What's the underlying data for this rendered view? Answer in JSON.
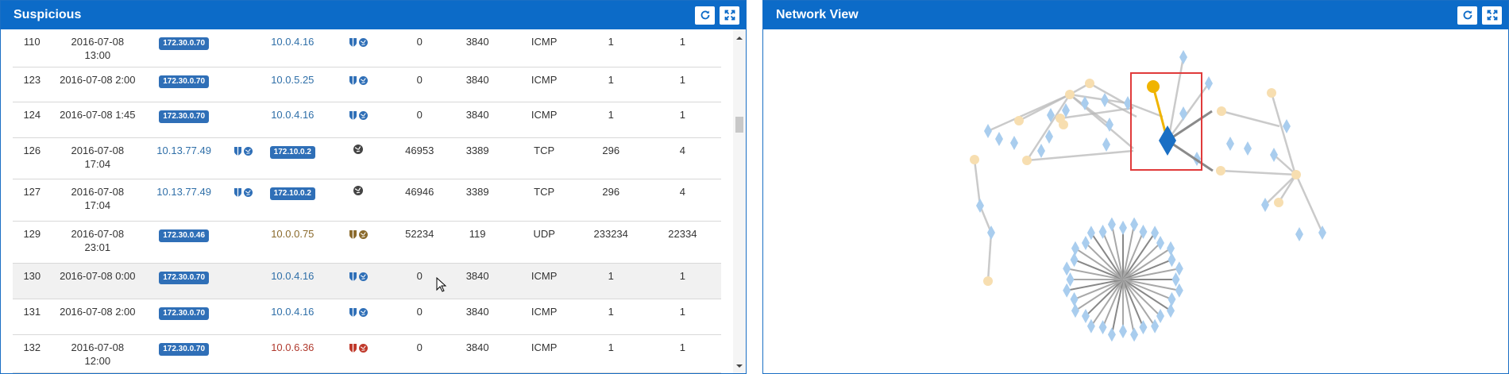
{
  "left_panel": {
    "title": "Suspicious"
  },
  "right_panel": {
    "title": "Network View"
  },
  "rows": [
    {
      "id": "110",
      "date": "2016-07-08",
      "time": "13:00",
      "src": "172.30.0.70",
      "src_type": "badge",
      "src_flags": "",
      "dst": "10.0.4.16",
      "dst_type": "link",
      "dst_color": "blue",
      "dst_flags": "shield-blue",
      "sport": "0",
      "dport": "3840",
      "proto": "ICMP",
      "bytes": "1",
      "pkts": "1"
    },
    {
      "id": "123",
      "date": "2016-07-08 2:00",
      "time": "",
      "src": "172.30.0.70",
      "src_type": "badge",
      "src_flags": "",
      "dst": "10.0.5.25",
      "dst_type": "link",
      "dst_color": "blue",
      "dst_flags": "shield-blue",
      "sport": "0",
      "dport": "3840",
      "proto": "ICMP",
      "bytes": "1",
      "pkts": "1"
    },
    {
      "id": "124",
      "date": "2016-07-08 1:45",
      "time": "",
      "src": "172.30.0.70",
      "src_type": "badge",
      "src_flags": "",
      "dst": "10.0.4.16",
      "dst_type": "link",
      "dst_color": "blue",
      "dst_flags": "shield-blue",
      "sport": "0",
      "dport": "3840",
      "proto": "ICMP",
      "bytes": "1",
      "pkts": "1"
    },
    {
      "id": "126",
      "date": "2016-07-08",
      "time": "17:04",
      "src": "10.13.77.49",
      "src_type": "link",
      "src_flags": "shield-blue",
      "dst": "172.10.0.2",
      "dst_type": "badge",
      "dst_color": "",
      "dst_flags": "globe",
      "sport": "46953",
      "dport": "3389",
      "proto": "TCP",
      "bytes": "296",
      "pkts": "4"
    },
    {
      "id": "127",
      "date": "2016-07-08",
      "time": "17:04",
      "src": "10.13.77.49",
      "src_type": "link",
      "src_flags": "shield-blue",
      "dst": "172.10.0.2",
      "dst_type": "badge",
      "dst_color": "",
      "dst_flags": "globe",
      "sport": "46946",
      "dport": "3389",
      "proto": "TCP",
      "bytes": "296",
      "pkts": "4"
    },
    {
      "id": "129",
      "date": "2016-07-08",
      "time": "23:01",
      "src": "172.30.0.46",
      "src_type": "badge",
      "src_flags": "",
      "dst": "10.0.0.75",
      "dst_type": "link",
      "dst_color": "brown",
      "dst_flags": "shield-brown",
      "sport": "52234",
      "dport": "119",
      "proto": "UDP",
      "bytes": "233234",
      "pkts": "22334"
    },
    {
      "id": "130",
      "date": "2016-07-08 0:00",
      "time": "",
      "src": "172.30.0.70",
      "src_type": "badge",
      "src_flags": "",
      "dst": "10.0.4.16",
      "dst_type": "link",
      "dst_color": "blue",
      "dst_flags": "shield-blue",
      "sport": "0",
      "dport": "3840",
      "proto": "ICMP",
      "bytes": "1",
      "pkts": "1"
    },
    {
      "id": "131",
      "date": "2016-07-08 2:00",
      "time": "",
      "src": "172.30.0.70",
      "src_type": "badge",
      "src_flags": "",
      "dst": "10.0.4.16",
      "dst_type": "link",
      "dst_color": "blue",
      "dst_flags": "shield-blue",
      "sport": "0",
      "dport": "3840",
      "proto": "ICMP",
      "bytes": "1",
      "pkts": "1"
    },
    {
      "id": "132",
      "date": "2016-07-08",
      "time": "12:00",
      "src": "172.30.0.70",
      "src_type": "badge",
      "src_flags": "",
      "dst": "10.0.6.36",
      "dst_type": "link",
      "dst_color": "red",
      "dst_flags": "shield-red",
      "sport": "0",
      "dport": "3840",
      "proto": "ICMP",
      "bytes": "1",
      "pkts": "1"
    }
  ],
  "colors": {
    "header": "#0c6bc8",
    "badge": "#2f6fb7",
    "link_blue": "#2f6fa8",
    "link_brown": "#8a6a2c",
    "link_red": "#b03a2e",
    "selected_node": "#1a6fc4",
    "highlight_edge": "#f0b400",
    "selection_box": "#e03b3b",
    "node_diamond": "#a9cdee",
    "node_circle": "#f7deb0"
  }
}
